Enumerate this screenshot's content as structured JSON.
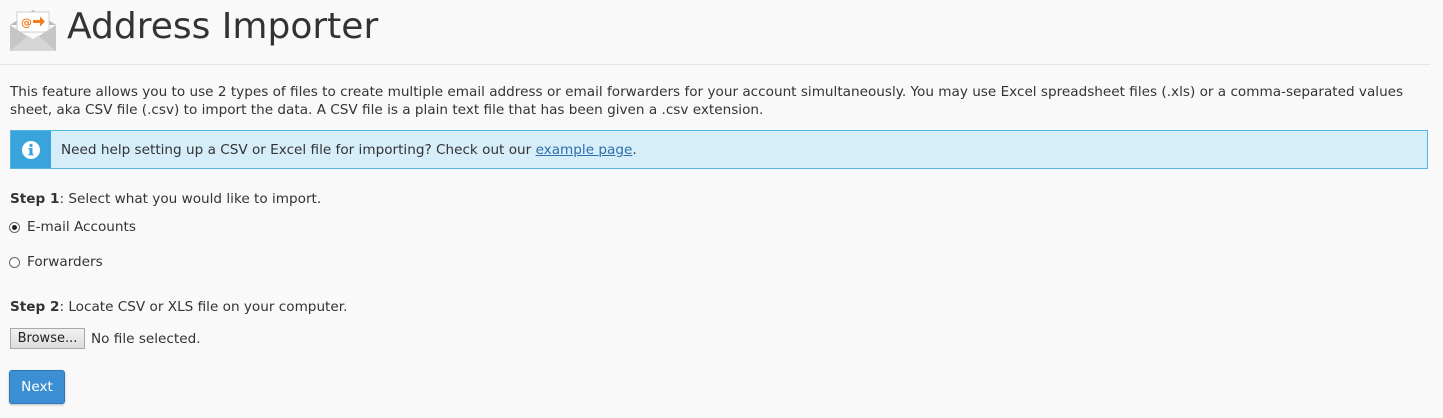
{
  "header": {
    "title": "Address Importer",
    "icon": "envelope-at-arrow-icon"
  },
  "description": "This feature allows you to use 2 types of files to create multiple email address or email forwarders for your account simultaneously. You may use Excel spreadsheet files (.xls) or a comma-separated values sheet, aka CSV file (.csv) to import the data. A CSV file is a plain text file that has been given a .csv extension.",
  "alert": {
    "icon": "info-icon",
    "text_before": "Need help setting up a CSV or Excel file for importing? Check out our ",
    "link_text": "example page",
    "text_after": "."
  },
  "step1": {
    "bold": "Step 1",
    "text": ": Select what you would like to import.",
    "options": [
      {
        "label": "E-mail Accounts",
        "checked": true
      },
      {
        "label": "Forwarders",
        "checked": false
      }
    ]
  },
  "step2": {
    "bold": "Step 2",
    "text": ": Locate CSV or XLS file on your computer.",
    "browse_label": "Browse...",
    "file_status": "No file selected."
  },
  "next_label": "Next",
  "colors": {
    "alert_bg": "#d6edfa",
    "alert_border": "#58b6e5",
    "alert_side": "#39a3dc",
    "link": "#2d6fa8",
    "primary_button": "#3d8fd4",
    "icon_orange": "#f07d22"
  }
}
